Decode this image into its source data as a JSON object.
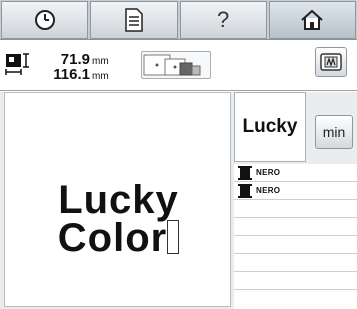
{
  "toolbar": {
    "buttons": [
      {
        "icon": "clock-icon"
      },
      {
        "icon": "document-icon"
      },
      {
        "icon": "help-icon",
        "label": "?"
      },
      {
        "icon": "home-icon"
      }
    ]
  },
  "size": {
    "height_value": "71.9",
    "height_unit": "mm",
    "width_value": "116.1",
    "width_unit": "mm"
  },
  "preview": {
    "line1": "Lucky",
    "line2": "Color"
  },
  "thumbnail": {
    "label": "Lucky"
  },
  "min_button": {
    "label": "min"
  },
  "threads": [
    {
      "name": "NERO",
      "color": "#111111"
    },
    {
      "name": "NERO",
      "color": "#111111"
    }
  ],
  "empty_rows": 6
}
